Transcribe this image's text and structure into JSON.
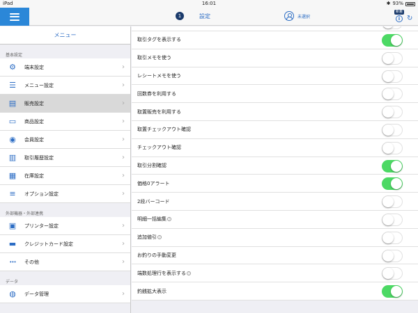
{
  "status_bar": {
    "device": "iPad",
    "time": "16:01",
    "battery": "93%"
  },
  "navbar": {
    "badge_number": "1",
    "title": "設定",
    "user_label": "未選択",
    "tag": "新着"
  },
  "sidebar": {
    "header": "メニュー",
    "sections": [
      {
        "label": "基本設定",
        "items": [
          {
            "label": "端末設定",
            "icon": "gear-icon"
          },
          {
            "label": "メニュー設定",
            "icon": "list-icon"
          },
          {
            "label": "販売設定",
            "icon": "register-icon",
            "selected": true
          },
          {
            "label": "商品設定",
            "icon": "box-icon"
          },
          {
            "label": "会員設定",
            "icon": "person-icon"
          },
          {
            "label": "取引履歴設定",
            "icon": "book-icon"
          },
          {
            "label": "在庫設定",
            "icon": "grid-icon"
          },
          {
            "label": "オプション設定",
            "icon": "options-icon"
          }
        ]
      },
      {
        "label": "外部機器・外部連携",
        "items": [
          {
            "label": "プリンター設定",
            "icon": "printer-icon"
          },
          {
            "label": "クレジットカード設定",
            "icon": "card-icon"
          },
          {
            "label": "その他",
            "icon": "more-icon"
          }
        ]
      },
      {
        "label": "データ",
        "items": [
          {
            "label": "データ管理",
            "icon": "database-icon"
          }
        ]
      }
    ]
  },
  "settings": [
    {
      "label": "取引タグを表示する",
      "on": true,
      "help": false
    },
    {
      "label": "取引メモを使う",
      "on": false,
      "help": false
    },
    {
      "label": "レシートメモを使う",
      "on": false,
      "help": false
    },
    {
      "label": "回数券を利用する",
      "on": false,
      "help": false
    },
    {
      "label": "取置販売を利用する",
      "on": false,
      "help": false
    },
    {
      "label": "取置チェックアウト確認",
      "on": false,
      "help": false
    },
    {
      "label": "チェックアウト確認",
      "on": false,
      "help": false
    },
    {
      "label": "取引分割確認",
      "on": true,
      "help": false
    },
    {
      "label": "価格0アラート",
      "on": true,
      "help": false
    },
    {
      "label": "2段バーコード",
      "on": false,
      "help": false
    },
    {
      "label": "明細一括編集",
      "on": false,
      "help": true
    },
    {
      "label": "追加値引",
      "on": false,
      "help": true
    },
    {
      "label": "お釣りの手動変更",
      "on": false,
      "help": false
    },
    {
      "label": "端数処理行を表示する",
      "on": false,
      "help": true
    },
    {
      "label": "釣銭拡大表示",
      "on": true,
      "help": false
    }
  ],
  "colors": {
    "accent": "#2b87d8",
    "toggle_on": "#4cd964"
  }
}
